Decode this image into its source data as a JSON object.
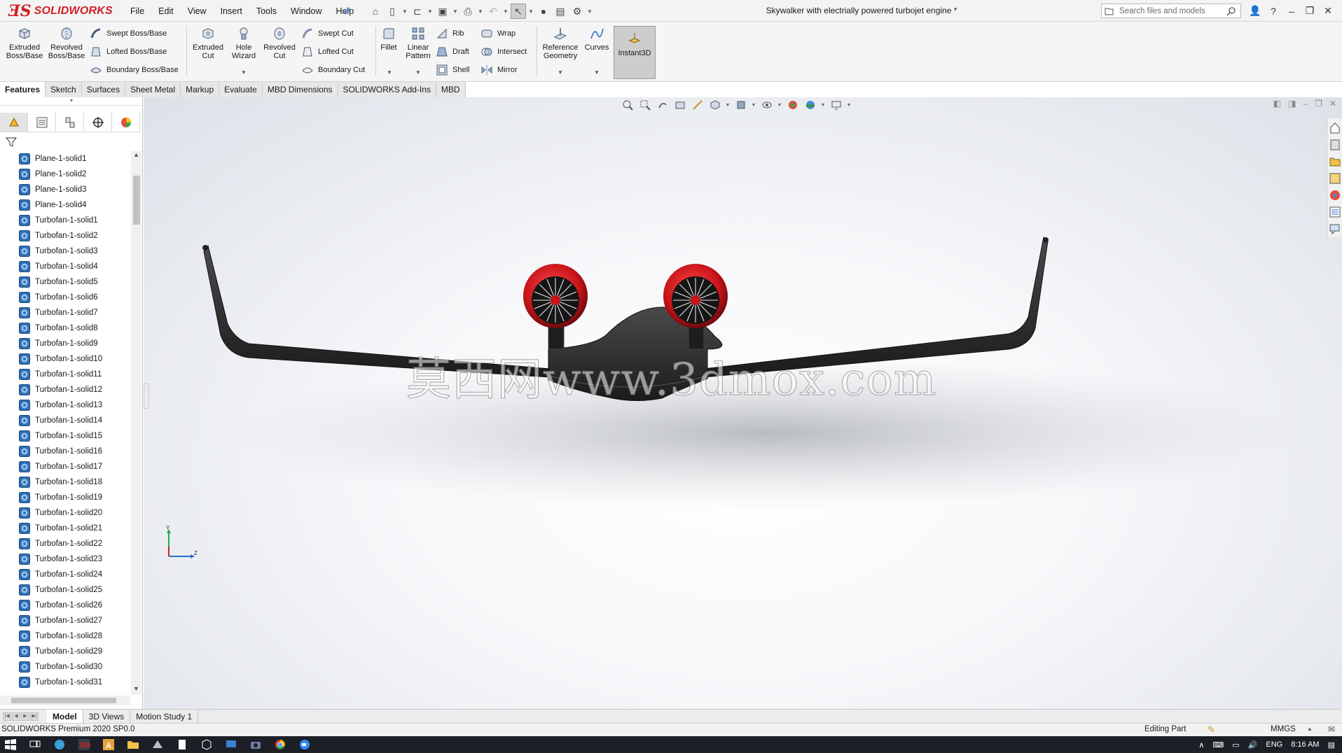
{
  "app": {
    "logo_text": "SOLIDWORKS",
    "menu": [
      "File",
      "Edit",
      "View",
      "Insert",
      "Tools",
      "Window",
      "Help"
    ],
    "document_title": "Skywalker with electrially powered turbojet engine *",
    "search_placeholder": "Search files and models",
    "help_label": "?"
  },
  "command_manager": {
    "extruded_boss": "Extruded Boss/Base",
    "revolved_boss": "Revolved Boss/Base",
    "swept_boss": "Swept Boss/Base",
    "lofted_boss": "Lofted Boss/Base",
    "boundary_boss": "Boundary Boss/Base",
    "extruded_cut": "Extruded Cut",
    "hole_wizard": "Hole Wizard",
    "revolved_cut": "Revolved Cut",
    "swept_cut": "Swept Cut",
    "lofted_cut": "Lofted Cut",
    "boundary_cut": "Boundary Cut",
    "fillet": "Fillet",
    "linear_pattern": "Linear Pattern",
    "rib": "Rib",
    "draft": "Draft",
    "shell": "Shell",
    "wrap": "Wrap",
    "intersect": "Intersect",
    "mirror": "Mirror",
    "reference_geometry": "Reference Geometry",
    "curves": "Curves",
    "instant3d": "Instant3D"
  },
  "cm_tabs": [
    "Features",
    "Sketch",
    "Surfaces",
    "Sheet Metal",
    "Markup",
    "Evaluate",
    "MBD Dimensions",
    "SOLIDWORKS Add-Ins",
    "MBD"
  ],
  "feature_tree": [
    "Plane-1-solid1",
    "Plane-1-solid2",
    "Plane-1-solid3",
    "Plane-1-solid4",
    "Turbofan-1-solid1",
    "Turbofan-1-solid2",
    "Turbofan-1-solid3",
    "Turbofan-1-solid4",
    "Turbofan-1-solid5",
    "Turbofan-1-solid6",
    "Turbofan-1-solid7",
    "Turbofan-1-solid8",
    "Turbofan-1-solid9",
    "Turbofan-1-solid10",
    "Turbofan-1-solid11",
    "Turbofan-1-solid12",
    "Turbofan-1-solid13",
    "Turbofan-1-solid14",
    "Turbofan-1-solid15",
    "Turbofan-1-solid16",
    "Turbofan-1-solid17",
    "Turbofan-1-solid18",
    "Turbofan-1-solid19",
    "Turbofan-1-solid20",
    "Turbofan-1-solid21",
    "Turbofan-1-solid22",
    "Turbofan-1-solid23",
    "Turbofan-1-solid24",
    "Turbofan-1-solid25",
    "Turbofan-1-solid26",
    "Turbofan-1-solid27",
    "Turbofan-1-solid28",
    "Turbofan-1-solid29",
    "Turbofan-1-solid30",
    "Turbofan-1-solid31"
  ],
  "viewport": {
    "watermark": "莫西网www.3dmox.com",
    "triad_y": "Y",
    "triad_z": "Z"
  },
  "model_tabs": [
    "Model",
    "3D Views",
    "Motion Study 1"
  ],
  "status": {
    "version": "SOLIDWORKS Premium 2020 SP0.0",
    "mode": "Editing Part",
    "units": "MMGS"
  },
  "taskbar": {
    "language": "ENG",
    "time": "8:16 AM"
  },
  "colors": {
    "brand_red": "#d11f26",
    "model_body": "#2b2b2b",
    "engine_red": "#c8141a"
  }
}
